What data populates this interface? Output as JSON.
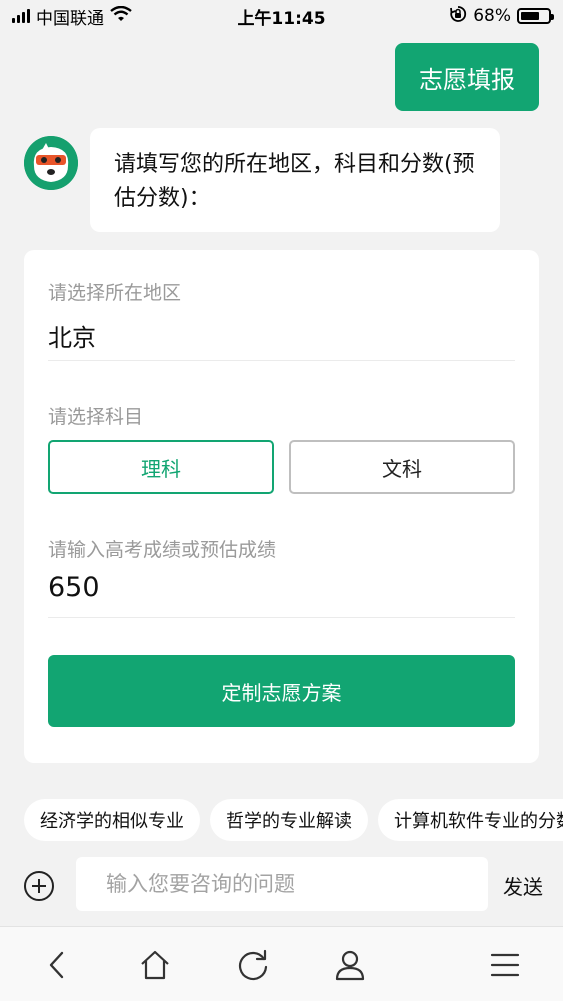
{
  "status_bar": {
    "carrier": "中国联通",
    "time": "上午11:45",
    "battery": "68%",
    "battery_level": 0.68
  },
  "chat": {
    "user_message": "志愿填报",
    "bot_message": "请填写您的所在地区，科目和分数(预估分数)："
  },
  "form": {
    "region_label": "请选择所在地区",
    "region_value": "北京",
    "subject_label": "请选择科目",
    "subject_options": [
      "理科",
      "文科"
    ],
    "selected_subject": "理科",
    "score_label": "请输入高考成绩或预估成绩",
    "score_value": "650",
    "submit_label": "定制志愿方案"
  },
  "suggestions": [
    "经济学的相似专业",
    "哲学的专业解读",
    "计算机软件专业的分数"
  ],
  "input_bar": {
    "placeholder": "输入您要咨询的问题",
    "send_label": "发送"
  },
  "colors": {
    "accent": "#12a572",
    "background": "#f2f2f2"
  },
  "icons": [
    "wifi-icon",
    "rotation-lock-icon",
    "back-icon",
    "home-icon",
    "refresh-icon",
    "user-icon",
    "menu-icon",
    "add-icon"
  ]
}
